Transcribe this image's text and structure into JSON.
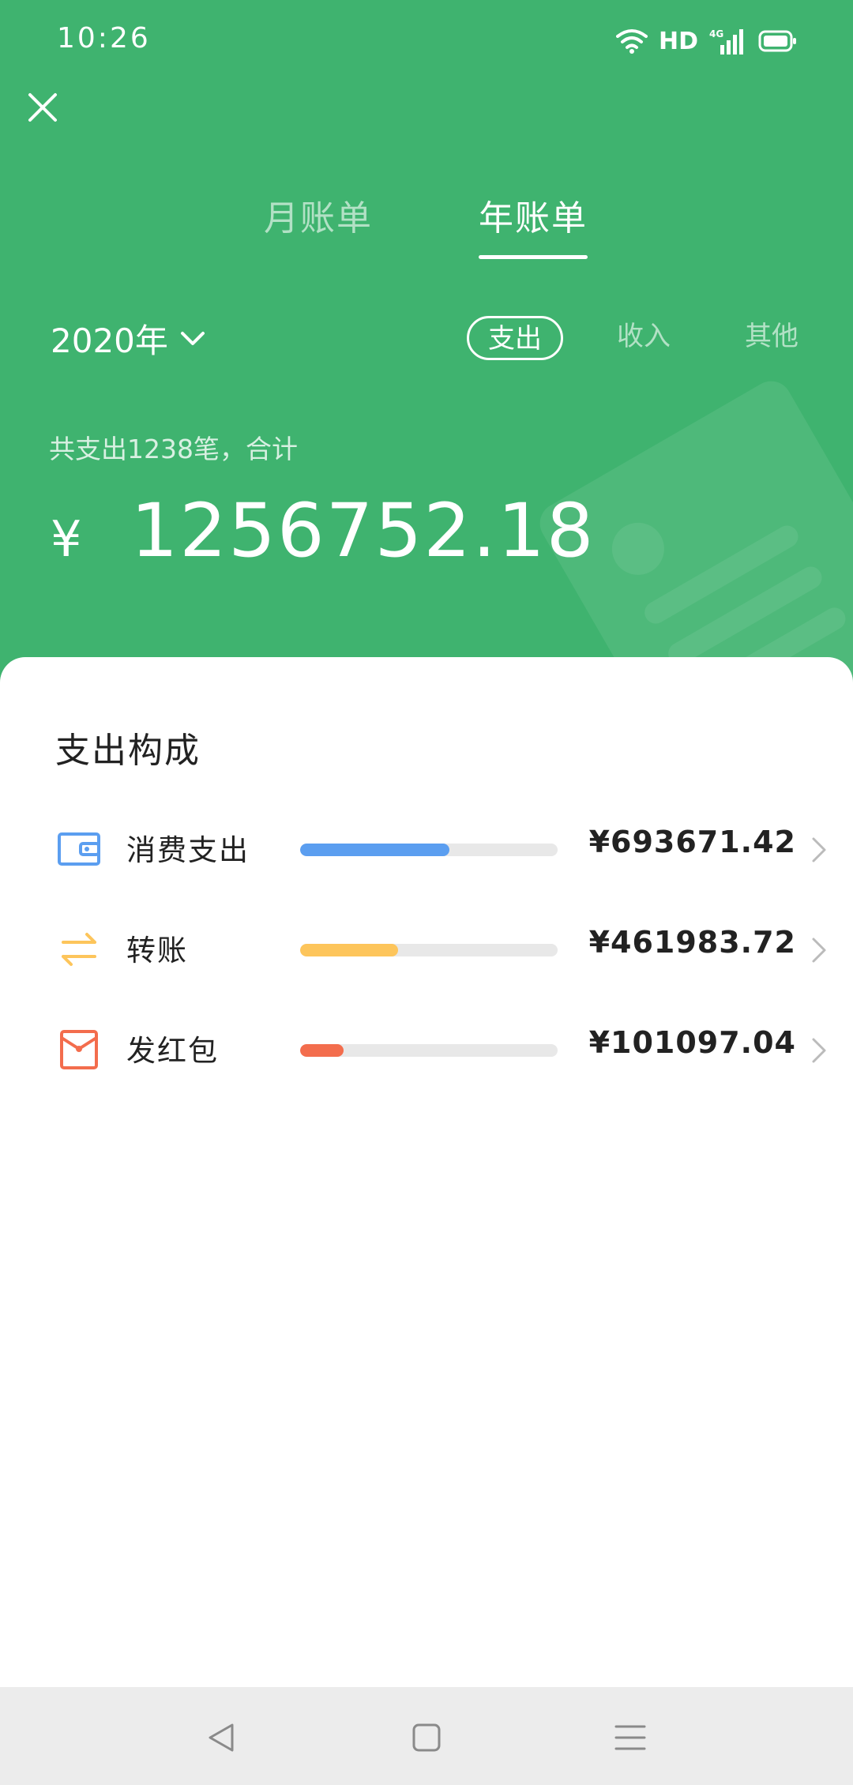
{
  "status": {
    "time": "10:26",
    "hd": "HD",
    "network": "4G"
  },
  "tabs": [
    {
      "label": "月账单",
      "active": false
    },
    {
      "label": "年账单",
      "active": true
    }
  ],
  "year_selector": {
    "label": "2020年"
  },
  "filters": [
    {
      "label": "支出",
      "active": true
    },
    {
      "label": "收入",
      "active": false
    },
    {
      "label": "其他",
      "active": false
    }
  ],
  "summary": {
    "text": "共支出1238笔，合计",
    "currency": "¥",
    "amount": "1256752.18"
  },
  "breakdown": {
    "title": "支出构成",
    "items": [
      {
        "label": "消费支出",
        "value": "¥693671.42",
        "fraction": 0.58,
        "color": "#5b9ef0",
        "icon": "wallet-icon"
      },
      {
        "label": "转账",
        "value": "¥461983.72",
        "fraction": 0.38,
        "color": "#fdc55b",
        "icon": "transfer-icon"
      },
      {
        "label": "发红包",
        "value": "¥101097.04",
        "fraction": 0.17,
        "color": "#f36d4d",
        "icon": "red-packet-icon"
      }
    ]
  },
  "colors": {
    "header_green": "#3fb36f",
    "accent_blue": "#5b9ef0",
    "accent_yellow": "#fdc55b",
    "accent_red": "#f36d4d"
  }
}
